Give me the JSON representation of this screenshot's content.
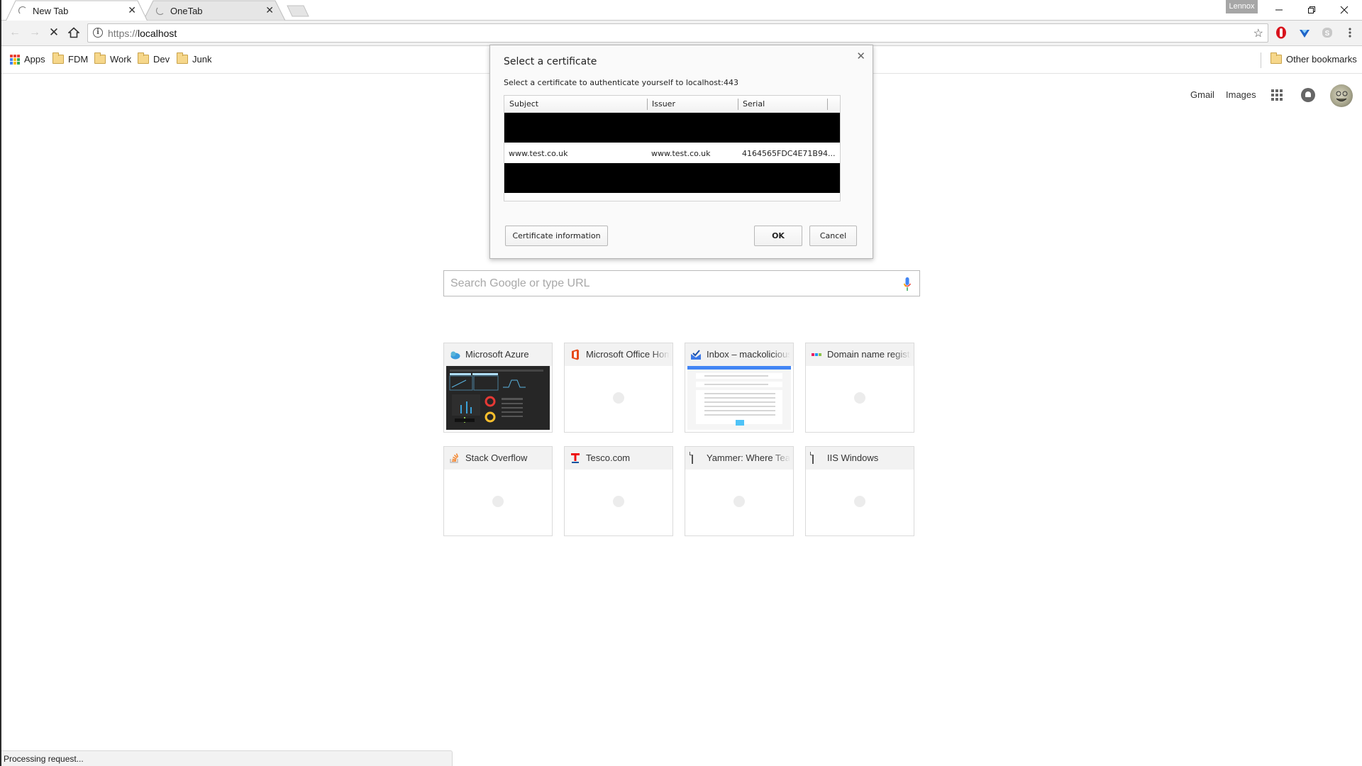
{
  "window": {
    "profile_name": "Lennox",
    "controls": {
      "minimize": "minimize",
      "restore": "restore",
      "close": "close"
    }
  },
  "tabs": [
    {
      "title": "New Tab",
      "active": true,
      "loading": true
    },
    {
      "title": "OneTab",
      "active": false,
      "loading": true
    }
  ],
  "toolbar": {
    "url_scheme": "https://",
    "url_host": "localhost",
    "extensions": [
      "opera-adblock-icon",
      "vpn-extension-icon",
      "skype-icon"
    ]
  },
  "bookmarks": {
    "items": [
      {
        "label": "Apps",
        "icon": "apps-grid-icon"
      },
      {
        "label": "FDM",
        "icon": "folder-icon"
      },
      {
        "label": "Work",
        "icon": "folder-icon"
      },
      {
        "label": "Dev",
        "icon": "folder-icon"
      },
      {
        "label": "Junk",
        "icon": "folder-icon"
      }
    ],
    "other_label": "Other bookmarks"
  },
  "ntp": {
    "gmail": "Gmail",
    "images": "Images",
    "search_placeholder": "Search Google or type URL",
    "search_value": "",
    "tiles": [
      {
        "title": "Microsoft Azure",
        "favicon": "azure-cloud-icon",
        "thumbnail": "dark-dashboard"
      },
      {
        "title": "Microsoft Office Home",
        "favicon": "office-icon",
        "thumbnail": "loading"
      },
      {
        "title": "Inbox – mackolicious@",
        "favicon": "inbox-icon",
        "thumbnail": "inbox-list"
      },
      {
        "title": "Domain name registration",
        "favicon": "domain-dots-icon",
        "thumbnail": "loading"
      },
      {
        "title": "Stack Overflow",
        "favicon": "stackoverflow-icon",
        "thumbnail": "loading"
      },
      {
        "title": "Tesco.com",
        "favicon": "tesco-icon",
        "thumbnail": "loading"
      },
      {
        "title": "Yammer: Where Teams",
        "favicon": "document-icon",
        "thumbnail": "loading"
      },
      {
        "title": "IIS Windows",
        "favicon": "document-icon",
        "thumbnail": "loading"
      }
    ]
  },
  "dialog": {
    "title": "Select a certificate",
    "subtitle": "Select a certificate to authenticate yourself to localhost:443",
    "columns": [
      "Subject",
      "Issuer",
      "Serial"
    ],
    "rows": [
      {
        "redacted": true
      },
      {
        "subject": "www.test.co.uk",
        "issuer": "www.test.co.uk",
        "serial": "4164565FDC4E71B94..."
      },
      {
        "redacted": true
      }
    ],
    "buttons": {
      "info": "Certificate information",
      "ok": "OK",
      "cancel": "Cancel"
    }
  },
  "status": {
    "text": "Processing request..."
  },
  "colors": {
    "accent_blue": "#4285f4",
    "opera_red": "#d8131d",
    "folder_yellow": "#f6d78b"
  }
}
